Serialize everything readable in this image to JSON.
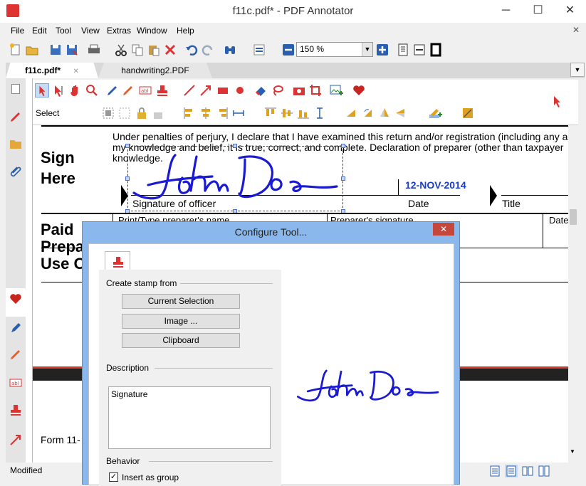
{
  "window": {
    "title": "f11c.pdf* - PDF Annotator",
    "minimize": "─",
    "maximize": "☐",
    "close": "✕",
    "close_sub": "✕"
  },
  "menu": [
    "File",
    "Edit",
    "Tool",
    "View",
    "Extras",
    "Window",
    "Help"
  ],
  "zoom": {
    "value": "150 %"
  },
  "tabs": [
    {
      "label": "f11c.pdf*",
      "close": "✕"
    },
    {
      "label": "handwriting2.PDF"
    }
  ],
  "annot_toolbar": {
    "select_label": "Select"
  },
  "document": {
    "perjury_text_1": "Under penalties of perjury, I declare that I have examined this return and/or registration (including any a",
    "perjury_text_2": "my knowledge and belief, it is true, correct, and complete. Declaration of preparer (other than taxpayer",
    "perjury_text_3": "knowledge.",
    "sign_here_1": "Sign",
    "sign_here_2": "Here",
    "date_value": "12-NOV-2014",
    "signature_label": "Signature of officer",
    "date_label": "Date",
    "title_label": "Title",
    "paid_1": "Paid",
    "paid_2": "Prepa",
    "paid_3": "Use O",
    "preparer_name_label": "Print/Type preparer's name",
    "preparer_sig_label": "Preparer's signature",
    "date_label2": "Date",
    "form_label": "Form 11-"
  },
  "dialog": {
    "title": "Configure Tool...",
    "close": "✕",
    "create_stamp_label": "Create stamp from",
    "btn_current_selection": "Current Selection",
    "btn_image": "Image ...",
    "btn_clipboard": "Clipboard",
    "description_label": "Description",
    "description_value": "Signature",
    "behavior_label": "Behavior",
    "insert_as_group": "Insert as group",
    "checkmark": "✓"
  },
  "signature_text": "John Doe",
  "status": {
    "text": "Modified"
  },
  "colors": {
    "accent": "#3c8ce0",
    "signature_blue": "#1a1ad4",
    "date_blue": "#1a3cc8",
    "red": "#d33b2c"
  }
}
